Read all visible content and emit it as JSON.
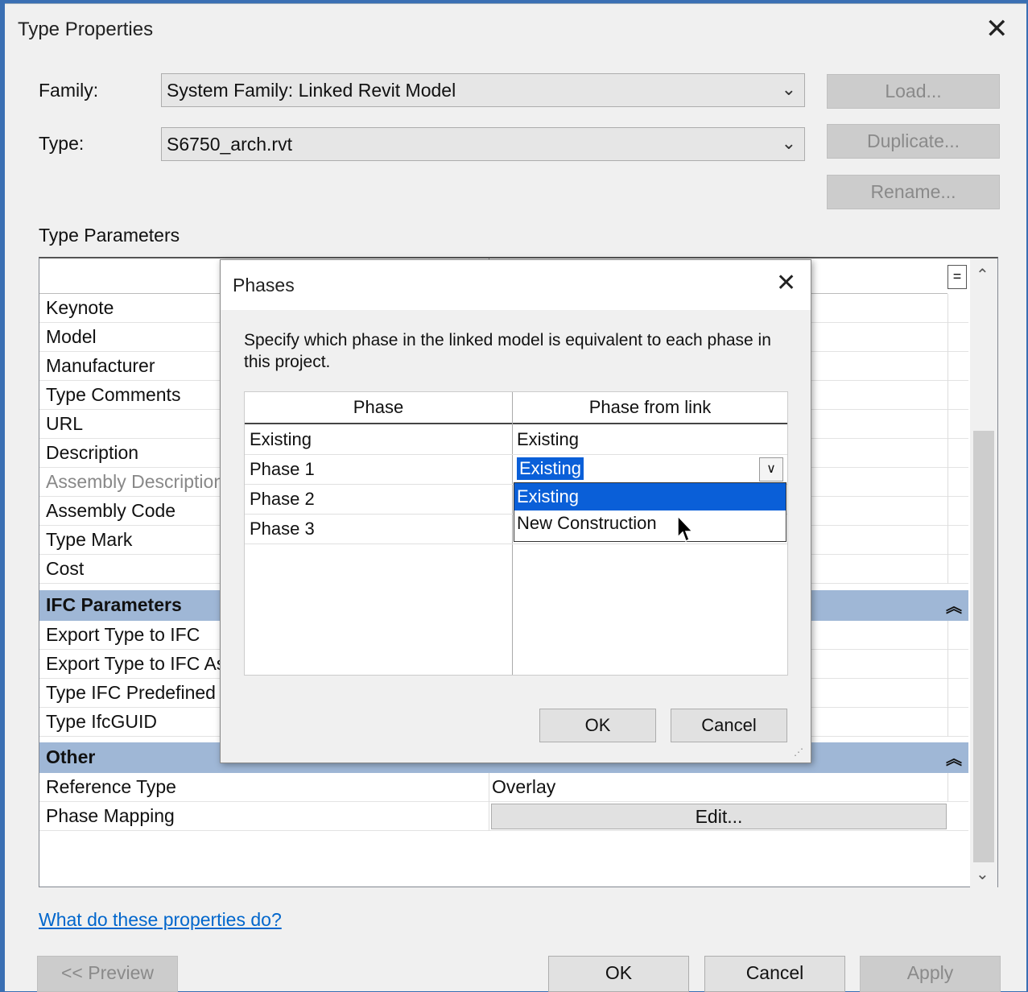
{
  "window": {
    "title": "Type Properties"
  },
  "family": {
    "label": "Family:",
    "value": "System Family: Linked Revit Model"
  },
  "type": {
    "label": "Type:",
    "value": "S6750_arch.rvt"
  },
  "side_buttons": {
    "load": "Load...",
    "duplicate": "Duplicate...",
    "rename": "Rename..."
  },
  "params": {
    "section_label": "Type Parameters",
    "eq_button": "=",
    "rows_top": [
      "Keynote",
      "Model",
      "Manufacturer",
      "Type Comments",
      "URL",
      "Description",
      "Assembly Description",
      "Assembly Code",
      "Type Mark",
      "Cost"
    ],
    "ifc_group": "IFC Parameters",
    "rows_ifc": [
      "Export Type to IFC",
      "Export Type to IFC As",
      "Type IFC Predefined",
      "Type IfcGUID"
    ],
    "other_group": "Other",
    "reference_type": {
      "name": "Reference Type",
      "value": "Overlay"
    },
    "phase_mapping": {
      "name": "Phase Mapping",
      "button": "Edit..."
    }
  },
  "help_link": "What do these properties do?",
  "footer": {
    "preview": "<< Preview",
    "ok": "OK",
    "cancel": "Cancel",
    "apply": "Apply"
  },
  "phases_dialog": {
    "title": "Phases",
    "instruction": "Specify which phase in the linked model is equivalent to each phase in this project.",
    "col_phase": "Phase",
    "col_link": "Phase from link",
    "rows": [
      {
        "phase": "Existing",
        "link": "Existing"
      },
      {
        "phase": "Phase 1",
        "link": "Existing"
      },
      {
        "phase": "Phase 2",
        "link": ""
      },
      {
        "phase": "Phase 3",
        "link": ""
      }
    ],
    "dropdown_options": [
      "Existing",
      "New Construction"
    ],
    "selected_option": "Existing",
    "ok": "OK",
    "cancel": "Cancel"
  },
  "colors": {
    "accent": "#0a5fd8",
    "group_header": "#9fb7d6",
    "link": "#0066cc"
  },
  "icons": {
    "close": "close-icon",
    "dropdown": "chevron-down-icon",
    "collapse": "collapse-up-icon",
    "cursor": "mouse-cursor-icon"
  }
}
